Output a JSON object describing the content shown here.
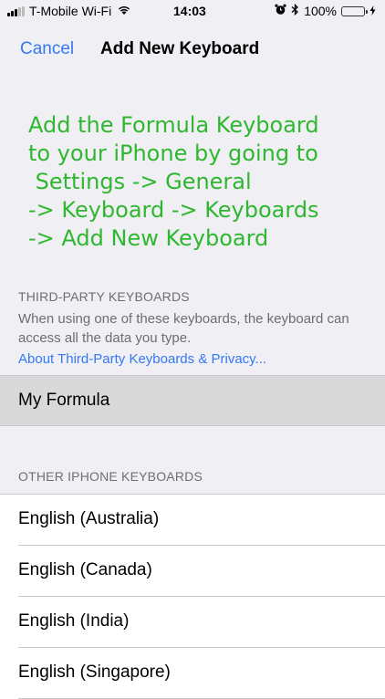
{
  "status_bar": {
    "carrier": "T-Mobile Wi-Fi",
    "time": "14:03",
    "alarm_icon": "alarm-clock-icon",
    "bluetooth_icon": "bluetooth-icon",
    "battery_percent": "100%",
    "battery_level": 1.0,
    "charging_icon": "bolt-icon"
  },
  "nav": {
    "cancel_label": "Cancel",
    "title": "Add New Keyboard"
  },
  "promo": {
    "text": "Add the Formula Keyboard\nto your iPhone by going to\n Settings -> General\n-> Keyboard -> Keyboards\n-> Add New Keyboard",
    "color": "#2fb82f"
  },
  "third_party": {
    "header": "THIRD-PARTY KEYBOARDS",
    "footer": "When using one of these keyboards, the keyboard can access all the data you type.",
    "link": "About Third-Party Keyboards & Privacy...",
    "items": [
      {
        "label": "My Formula"
      }
    ]
  },
  "other": {
    "header": "OTHER IPHONE KEYBOARDS",
    "items": [
      {
        "label": "English (Australia)"
      },
      {
        "label": "English (Canada)"
      },
      {
        "label": "English (India)"
      },
      {
        "label": "English (Singapore)"
      }
    ]
  },
  "colors": {
    "accent": "#3478f6",
    "background": "#efeff4",
    "battery": "#4cd964"
  }
}
